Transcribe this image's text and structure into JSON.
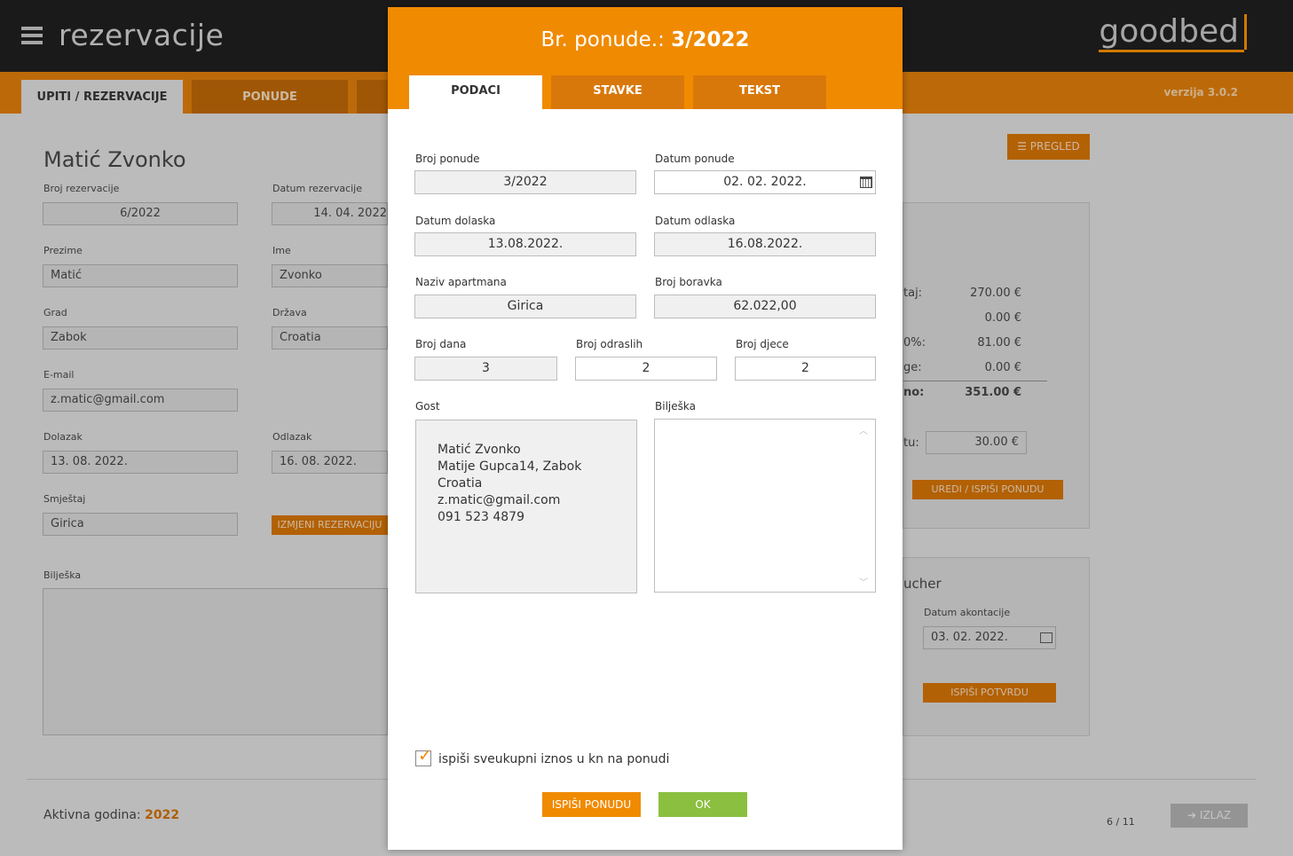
{
  "app": {
    "title": "rezervacije",
    "logo": "goodbed",
    "version": "verzija 3.0.2",
    "tabs": [
      "UPITI / REZERVACIJE",
      "PONUDE"
    ],
    "pregled_label": "PREGLED"
  },
  "form": {
    "name_heading": "Matić Zvonko",
    "broj_rezervacije_label": "Broj rezervacije",
    "broj_rezervacije": "6/2022",
    "datum_rezervacije_label": "Datum rezervacije",
    "datum_rezervacije": "14. 04. 2022",
    "prezime_label": "Prezime",
    "prezime": "Matić",
    "ime_label": "Ime",
    "ime": "Zvonko",
    "grad_label": "Grad",
    "grad": "Zabok",
    "drzava_label": "Država",
    "drzava": "Croatia",
    "email_label": "E-mail",
    "email": "z.matic@gmail.com",
    "dolazak_label": "Dolazak",
    "dolazak": "13. 08. 2022.",
    "odlazak_label": "Odlazak",
    "odlazak": "16. 08. 2022.",
    "smjestaj_label": "Smještaj",
    "smjestaj": "Girica",
    "izmjeni_label": "IZMJENI REZERVACIJU",
    "biljeska_label": "Bilješka"
  },
  "summary": {
    "rows": [
      {
        "label": "taj:",
        "value": "270.00 €"
      },
      {
        "label": "",
        "value": "0.00 €"
      },
      {
        "label": "0%:",
        "value": "81.00 €"
      },
      {
        "label": "ge:",
        "value": "0.00 €"
      },
      {
        "label": "no:",
        "value": "351.00 €"
      }
    ],
    "tu_label": "tu:",
    "tu_value": "30.00 €",
    "uredi_label": "UREDI / ISPIŠI PONUDU",
    "voucher_title": "ucher",
    "datum_akontacije_label": "Datum akontacije",
    "datum_akontacije": "03. 02. 2022.",
    "ispisi_potvrdu_label": "ISPIŠI POTVRDU"
  },
  "footer": {
    "aktivna_label": "Aktivna godina:",
    "aktivna_year": "2022",
    "pager": "6 / 11",
    "izlaz_label": "IZLAZ"
  },
  "modal": {
    "title_prefix": "Br. ponude.:",
    "title_value": "3/2022",
    "tabs": [
      "PODACI",
      "STAVKE",
      "TEKST"
    ],
    "broj_ponude_label": "Broj ponude",
    "broj_ponude": "3/2022",
    "datum_ponude_label": "Datum ponude",
    "datum_ponude": "02. 02. 2022.",
    "datum_dolaska_label": "Datum dolaska",
    "datum_dolaska": "13.08.2022.",
    "datum_odlaska_label": "Datum odlaska",
    "datum_odlaska": "16.08.2022.",
    "naziv_apartmana_label": "Naziv apartmana",
    "naziv_apartmana": "Girica",
    "broj_boravka_label": "Broj boravka",
    "broj_boravka": "62.022,00",
    "broj_dana_label": "Broj dana",
    "broj_dana": "3",
    "broj_odraslih_label": "Broj odraslih",
    "broj_odraslih": "2",
    "broj_djece_label": "Broj djece",
    "broj_djece": "2",
    "gost_label": "Gost",
    "gost_lines": [
      "Matić Zvonko",
      "Matije Gupca14, Zabok",
      "Croatia",
      "z.matic@gmail.com",
      "091 523 4879"
    ],
    "biljeska_label": "Bilješka",
    "checkbox_label": "ispiši sveukupni iznos u kn na ponudi",
    "checkbox_checked": true,
    "print_button": "ISPIŠI PONUDU",
    "ok_button": "OK"
  },
  "colors": {
    "accent": "#f08a00",
    "ok_green": "#8bbf3f",
    "topbar": "#1e1e1e"
  }
}
